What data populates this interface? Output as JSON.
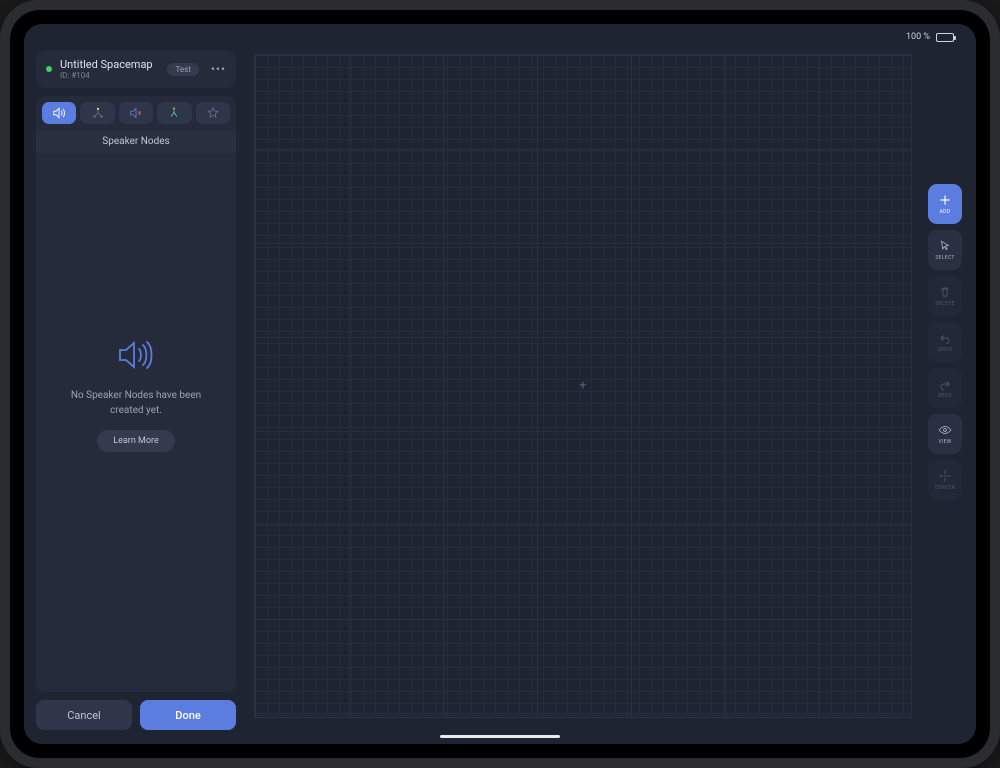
{
  "status": {
    "battery_pct": "100 %"
  },
  "header": {
    "title": "Untitled Spacemap",
    "id_label": "ID: #104",
    "test_label": "Test",
    "more_glyph": "•••"
  },
  "tabs": {
    "section_title": "Speaker Nodes"
  },
  "empty": {
    "message": "No Speaker Nodes have been created yet.",
    "learn_label": "Learn More"
  },
  "footer": {
    "cancel": "Cancel",
    "done": "Done"
  },
  "tools": {
    "add": "ADD",
    "select": "SELECT",
    "delete": "DELETE",
    "undo": "UNDO",
    "redo": "REDO",
    "view": "VIEW",
    "center": "CENTER"
  }
}
